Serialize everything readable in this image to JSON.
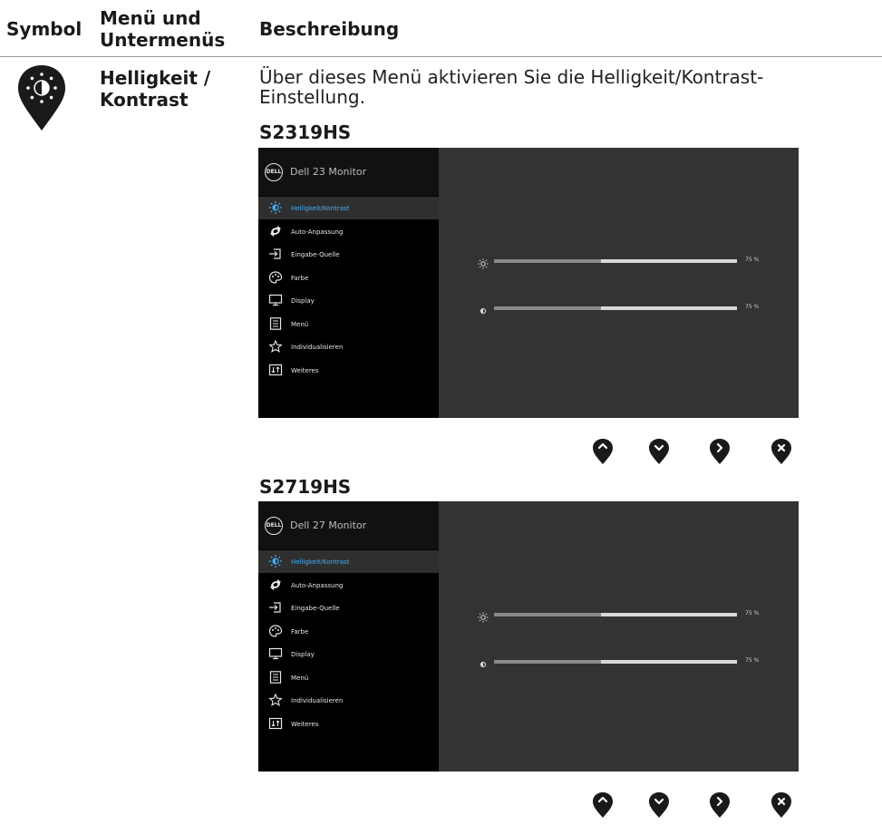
{
  "header": {
    "symbol": "Symbol",
    "menu_line1": "Menü und",
    "menu_line2": "Untermenüs",
    "description": "Beschreibung"
  },
  "row": {
    "symbol_icon": "brightness-contrast-icon",
    "name_line1": "Helligkeit /",
    "name_line2": "Kontrast",
    "description": "Über dieses Menü aktivieren Sie die Helligkeit/Kontrast-Einstellung."
  },
  "osd_common": {
    "logo_text": "DELL",
    "menu_items": [
      {
        "label": "Helligkeit/Kontrast",
        "icon": "brightness-icon",
        "selected": true
      },
      {
        "label": "Auto-Anpassung",
        "icon": "auto-adjust-icon",
        "selected": false
      },
      {
        "label": "Eingabe-Quelle",
        "icon": "input-source-icon",
        "selected": false
      },
      {
        "label": "Farbe",
        "icon": "color-palette-icon",
        "selected": false
      },
      {
        "label": "Display",
        "icon": "display-icon",
        "selected": false
      },
      {
        "label": "Menü",
        "icon": "menu-icon",
        "selected": false
      },
      {
        "label": "Individualisieren",
        "icon": "star-icon",
        "selected": false
      },
      {
        "label": "Weiteres",
        "icon": "others-icon",
        "selected": false
      }
    ],
    "brightness": {
      "value": 75,
      "label": "75 %",
      "icon": "sun-icon"
    },
    "contrast": {
      "value": 75,
      "label": "75 %",
      "icon": "contrast-icon"
    },
    "nav_buttons": [
      "up-button-icon",
      "down-button-icon",
      "right-button-icon",
      "close-button-icon"
    ]
  },
  "models": [
    {
      "name": "S2319HS",
      "monitor_title": "Dell 23 Monitor"
    },
    {
      "name": "S2719HS",
      "monitor_title": "Dell 27 Monitor"
    }
  ],
  "colors": {
    "selected_text": "#3fb0ff",
    "osd_panel": "#333333",
    "button_dark": "#1a1a1a"
  }
}
